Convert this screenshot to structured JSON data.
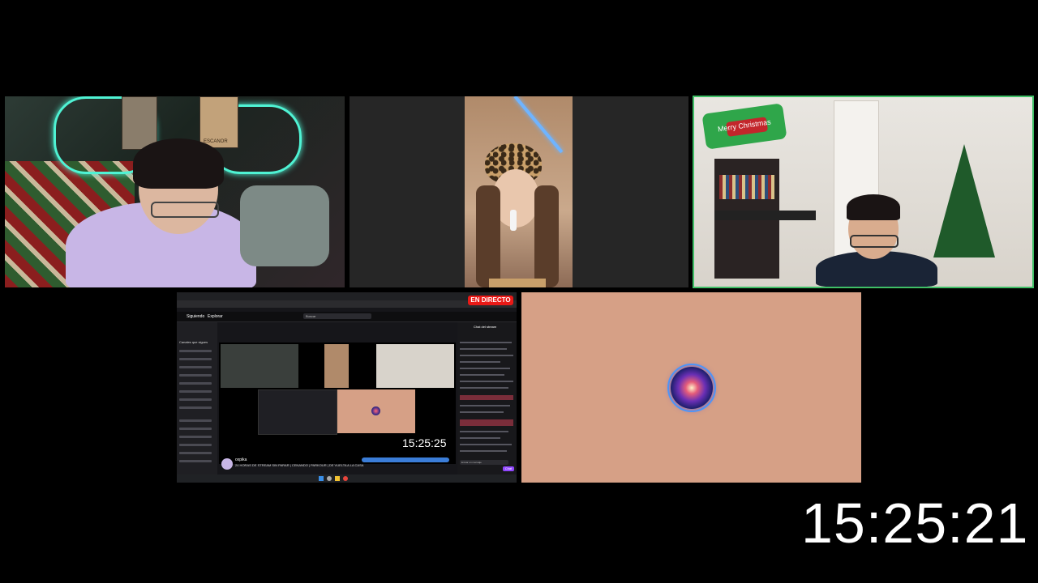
{
  "main_clock": "15:25:21",
  "poster_text": "ESCANOR",
  "holiday_sign": "Merry Christmas",
  "browser": {
    "live_badge": "EN DIRECTO",
    "nav_following": "Siguiendo",
    "nav_browse": "Explorar",
    "search_placeholder": "Buscar",
    "inner_clock": "15:25:25",
    "channel_name": "oxpika",
    "stream_title": "24 HORAS DE STREAM SIN PARAR | CENANDO | PARKOUR | DE VUELTA A LA CASA",
    "sidebar_heading": "Canales que sigues",
    "chat_heading": "Chat del stream",
    "chat_input_placeholder": "Enviar un mensaje",
    "chat_button": "Chat"
  },
  "colors": {
    "accent_live": "#e91916",
    "tile_highlight": "#3fbf66",
    "twitch_purple": "#9147ff",
    "background": "#000000"
  },
  "icons": {
    "tile5": "galaxy-orb-icon"
  }
}
